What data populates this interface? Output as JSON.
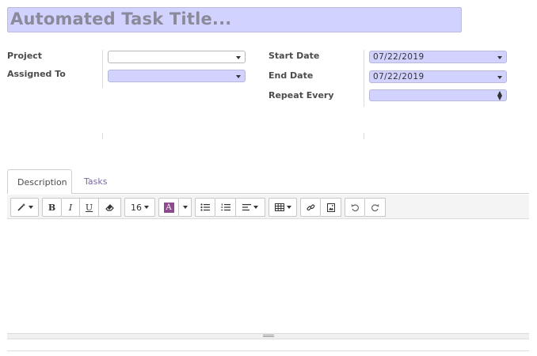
{
  "title": {
    "placeholder": "Automated Task Title..."
  },
  "fields": {
    "project": {
      "label": "Project",
      "value": ""
    },
    "assigned_to": {
      "label": "Assigned To",
      "value": ""
    },
    "start_date": {
      "label": "Start Date",
      "value": "07/22/2019"
    },
    "end_date": {
      "label": "End Date",
      "value": "07/22/2019"
    },
    "repeat_every": {
      "label": "Repeat Every",
      "value": ""
    }
  },
  "tabs": [
    {
      "label": "Description",
      "active": true
    },
    {
      "label": "Tasks",
      "active": false
    }
  ],
  "toolbar": {
    "style_icon": "magic-wand-icon",
    "bold": "B",
    "italic": "I",
    "underline": "U",
    "eraser_icon": "eraser-icon",
    "font_size": "16",
    "color_letter": "A",
    "colors": {
      "accent": "#8e4a8e",
      "required_bg": "#d2d2ff",
      "tab_link": "#7c6aa3"
    }
  }
}
